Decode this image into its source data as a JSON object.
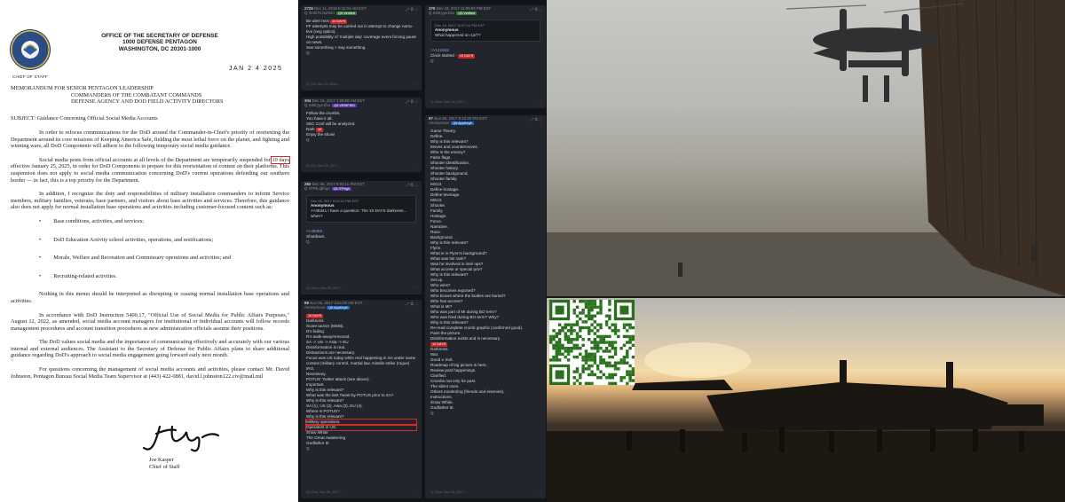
{
  "memo": {
    "seal_caption": "CHIEF OF STAFF",
    "header_lines": [
      "OFFICE OF THE SECRETARY OF DEFENSE",
      "1000 DEFENSE PENTAGON",
      "WASHINGTON, DC 20301-1000"
    ],
    "date": "JAN 2 4 2025",
    "addressees": [
      "MEMORANDUM FOR SENIOR PENTAGON LEADERSHIP",
      "COMMANDERS OF THE COMBATANT COMMANDS",
      "DEFENSE AGENCY AND DOD FIELD ACTIVITY DIRECTORS"
    ],
    "subject": "SUBJECT:  Guidance Concerning Official Social Media Accounts",
    "para1": "In order to refocus communications for the DoD around the Commander-in-Chief's priority of reorienting the Department around its core missions of Keeping America Safe, fielding the most lethal force on the planet, and fighting and winning wars, all DoD Components will adhere to the following temporary social media guidance.",
    "para2_a": "Social media posts from official accounts at all levels of the Department are temporarily suspended for ",
    "para2_hl": "10 days",
    "para2_b": " effective January 25, 2025, in order for DoD Components to prepare for this reorientation of content on their platforms.  This suspension does not apply to social media communication concerning DoD's current operations defending our southern border — in fact, this is a top priority for the Department.",
    "para3": "In addition, I recognize the duty and responsibilities of military installation commanders to inform Service members, military families, veterans, base partners, and visitors about base activities and services.  Therefore, this guidance also does not apply for normal installation base operations and activities including customer-focused content such as:",
    "bullets": [
      "Base conditions, activities, and services;",
      "DoD Education Activity school activities, operations, and notifications;",
      "Morale, Welfare and Recreation and Commissary operations and activities; and",
      "Recruiting-related activities."
    ],
    "para4": "Nothing in this memo should be interpreted as disrupting or ceasing normal installation base operations and activities.",
    "para5": "In accordance with DoD Instruction 5400.17, \"Official Use of Social Media for Public Affairs Purposes,\" August 12, 2022, as amended, social media account managers for institutional or individual accounts will follow records management procedures and account transition procedures as new administration officials assume their positions.",
    "para6": "The DoD values social media and the importance of communicating effectively and accurately with our various internal and external audiences.  The Assistant to the Secretary of Defense for Public Affairs plans to share additional guidance regarding DoD's approach to social media engagement going forward early next month.",
    "para7": "For questions concerning the management of social media accounts and activities, please contact Mr. David Johnston, Pentagon Bureau Social Media Team Supervisor at (443) 422-0881, david.l.johnston122.civ@mail.mil",
    "sig_name": "Joe Kasper",
    "sig_title": "Chief of Staff"
  },
  "posts": [
    {
      "num": "2726",
      "date": "Dec 11, 2018 5:11:04 AM EST",
      "id": "Q !!mG7VJxZNCI",
      "tag": "Q5 Verified",
      "tagc": "#2e7d32",
      "lines": [
        "Be alert next [10 DAYS]",
        "FF attempts may be carried out in attempt to change narra-",
        "tive (neg optics).",
        "High possibility of 'multiple day' coverage event forcing pause",
        "on news.",
        "See something > Say something.",
        "Q"
      ],
      "footer": "Q | Fri, Dec 11, 2018 ..."
    },
    {
      "num": "370",
      "date": "Dec 18, 2017 11:09:04 PM EST",
      "id": "Q !UW.yye1fxo",
      "tag": "Q5 Verified",
      "tagc": "#2e7d32",
      "quote_head": "Dec 18, 2017 11:07:12 PM EST",
      "quote_author": "Anonymous",
      "quote_text": "What happened on 12/7?",
      "lines": [
        ">>121553",
        "Clock started - [10 DAYS]",
        "Q"
      ],
      "footer": "Q | Mon, Dec 18, 2017 ..."
    },
    {
      "num": "304",
      "date": "Dec 15, 2017 1:29:58 AM EST",
      "id": "Q !UW.yye1fxo",
      "tag": "Q5 VERIFIED",
      "tagc": "#5e35b1",
      "lines": [
        "Follow the crumbs.",
        "You have it all.",
        "SEC Conf will be analyzed.",
        "Dark [10].",
        "Enjoy the show!",
        "Q"
      ],
      "footer": "Q | Fri, Dec 15, 2017 ..."
    },
    {
      "num": "97",
      "date": "Nov 05, 2017 6:15:26 PM EST",
      "id": "Anonymous",
      "tag": "Q5 AppKey8",
      "tagc": "#1565c0",
      "lines": [
        "Game Theory.",
        "Define.",
        "Why is this relevant?",
        "Moves and countermoves.",
        "Who is the enemy?",
        "False flags.",
        "Shooter identification.",
        "Shooter history.",
        "Shooter background.",
        "Shooter family.",
        "MS13.",
        "Define hostage.",
        "Define leverage.",
        "MS13.",
        "Shooter.",
        "Family.",
        "Hostage.",
        "Force.",
        "Narrative.",
        "Race.",
        "Background.",
        "Why is this relevant?",
        "Flynn.",
        "What is in Flynn's background?",
        "What was his rank?",
        "Was he involved in intel ops?",
        "What access or special priv?",
        "Why is this relevant?",
        "Set up.",
        "Who wins?",
        "Who becomes exposed?",
        "Who knows where the bodies are buried?",
        "Who has access?",
        "What is MI?",
        "Who was part of MI during BO term?",
        "Who was fired during BO term? Why?",
        "Why is this relevant?",
        "Re-read complete crumb graphic (confirmed good).",
        "Paint the picture.",
        "Disinformation exists and is necessary.",
        "[10 DAYS]",
        "Darkness.",
        "War.",
        "Good v. Evil.",
        "Roadmap of big picture is here.",
        "Review post happenings.",
        "Clarified.",
        "Crumbs not only for past.",
        "The silent ones.",
        "Others monitoring (friends and enemies).",
        "Instructions.",
        "Snow White.",
        "Godfather III.",
        "Q"
      ],
      "footer": "Q | Sun, Nov 05, 2017 ..."
    },
    {
      "num": "282",
      "date": "Dec 06, 2017 9:03:11 PM EST",
      "id": "Q !ITPb.qbhqo",
      "tag": "Q5 ITPbgh",
      "tagc": "#5e35b1",
      "quote_head": "Dec 06, 2017 9:02:41 PM EST",
      "quote_author": "Anonymous",
      "quote_text": ">>45341  I have a question: The [10 DAYS] darkness... when?",
      "lines": [
        ">>45365",
        "Shutdown.",
        "Q"
      ],
      "footer": "Q | Wed, Dec 06, 2017 ..."
    },
    {
      "num": "88",
      "date": "Nov 05, 2017 3:51:00 AM EST",
      "id": "Anonymous",
      "tag": "Q5 AppKey8",
      "tagc": "#1565c0",
      "lines": [
        "[10 DAYS]",
        "Darkness.",
        "Scare tactics (MSM).",
        "D's failing.",
        "R's walk-away/removed.",
        "SA -> US -> Asia -> EU",
        "Disinformation is real.",
        "Distractions are necessary.",
        "Focus was US today while real happening in SA under same",
        "context (military control, martial law, missile strike (rogue)",
        "IRO.",
        "Necessary.",
        "POTUS' Twitter attack (see above).",
        "Important.",
        "Why is this relevant?",
        "What was the last Tweet by POTUS prior to SA?",
        "Why is this relevant?",
        "SA (1), US (2), Asia (3), EU (4).",
        "Where is POTUS?",
        "Why is this relevant?",
        "Military operations.",
        "Operators in US.",
        "Snow White",
        "The Great Awakening",
        "Godfather III",
        "Q"
      ],
      "footer": "Q | Sun, Nov 05, 2017 ..."
    }
  ]
}
